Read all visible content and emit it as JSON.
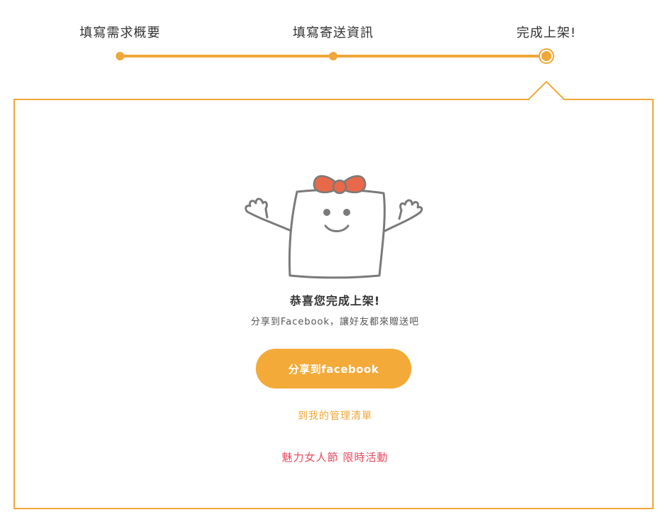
{
  "steps": [
    {
      "label": "填寫需求概要",
      "state": "done"
    },
    {
      "label": "填寫寄送資訊",
      "state": "done"
    },
    {
      "label": "完成上架!",
      "state": "current"
    }
  ],
  "colors": {
    "accent": "#f0a738",
    "button": "#f3aa39",
    "promo": "#e84a5f",
    "bow": "#e8694a"
  },
  "success": {
    "heading": "恭喜您完成上架!",
    "subtext": "分享到Facebook，讓好友都來贈送吧",
    "share_button": "分享到facebook",
    "manage_link": "到我的管理清單",
    "promo_link": "魅力女人節 限時活動"
  },
  "icons": {
    "mascot": "happy-box-mascot-with-bow"
  }
}
